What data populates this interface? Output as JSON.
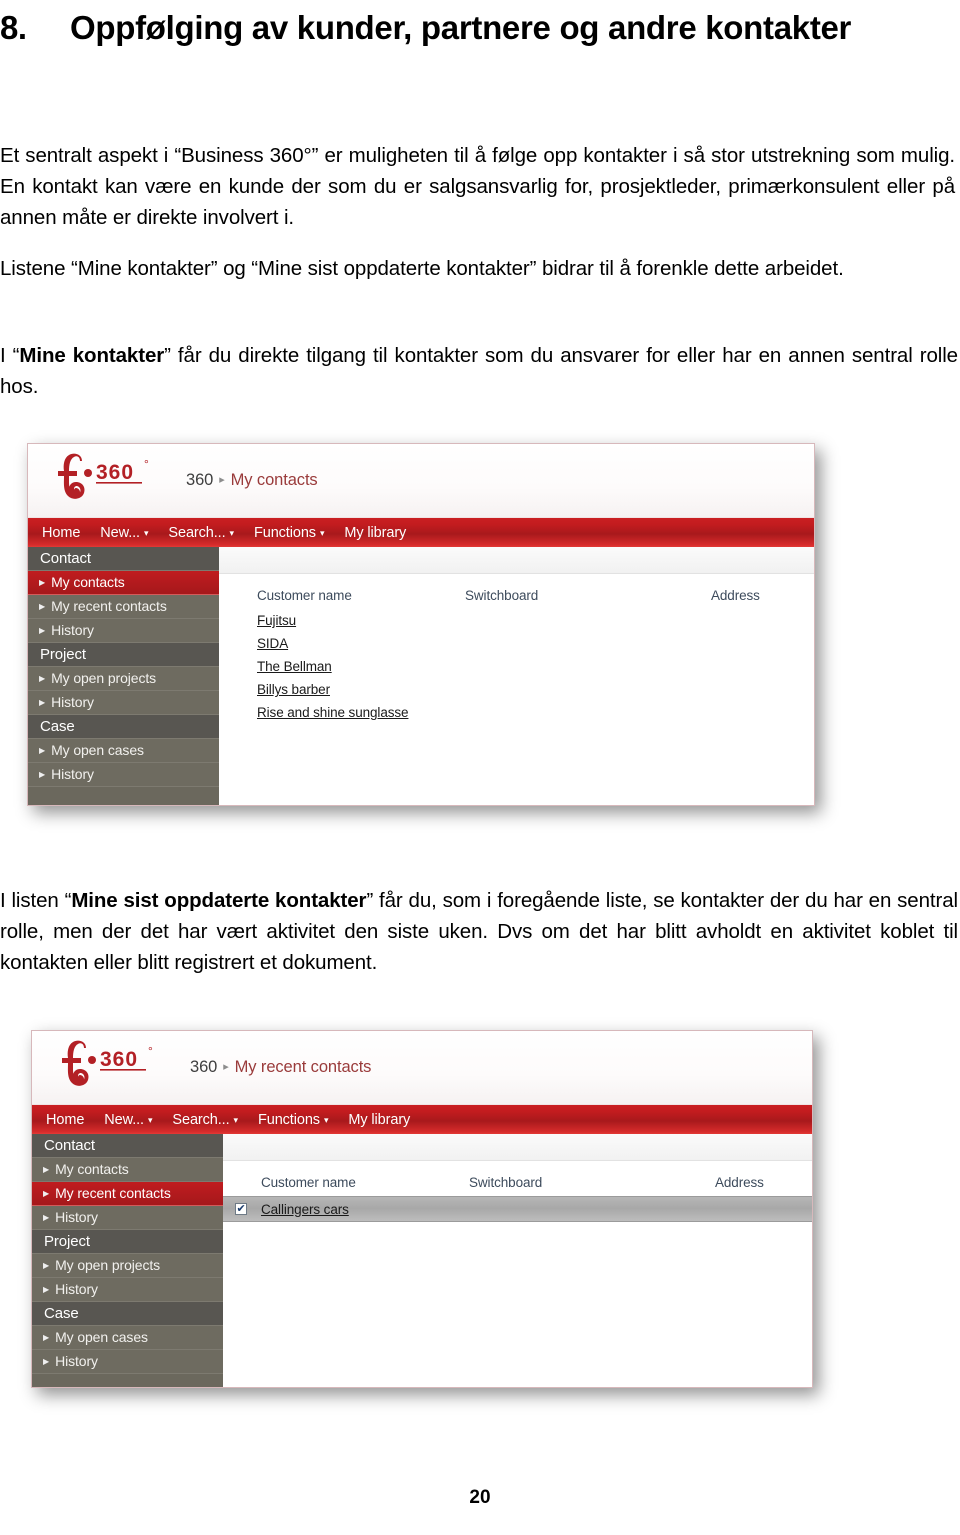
{
  "document": {
    "heading_number": "8.",
    "heading_title": "Oppfølging av kunder, partnere og andre kontakter",
    "paragraph_1": "Et sentralt aspekt i “Business 360°” er muligheten til å følge opp kontakter i så stor utstrekning som mulig. En kontakt kan være en kunde der som du er salgsansvarlig for, prosjektleder, primærkonsulent eller på annen måte er direkte involvert i.",
    "paragraph_2": "Listene “Mine kontakter” og “Mine sist oppdaterte kontakter” bidrar til å forenkle dette arbeidet.",
    "paragraph_3_pre": "I “",
    "paragraph_3_bold": "Mine kontakter",
    "paragraph_3_post": "” får du direkte tilgang til kontakter som du ansvarer for eller har en annen sentral rolle hos.",
    "paragraph_4_pre": "I listen “",
    "paragraph_4_bold": "Mine sist oppdaterte kontakter",
    "paragraph_4_post": "” får du, som i foregående liste, se kontakter der du har en sentral rolle, men der det har vært aktivitet den siste uken. Dvs om det har blitt avholdt en aktivitet koblet til kontakten eller blitt registrert et dokument.",
    "page_number": "20"
  },
  "colors": {
    "brand_red": "#c01c1f",
    "nav_red_dark": "#a8191c",
    "sidebar_group": "#585651",
    "sidebar_item": "#6e6b60",
    "breadcrumb_current": "#9a3b3b",
    "column_header": "#3d4b5c",
    "row_selected": "#a8a8a8"
  },
  "screenshot_1": {
    "logo": {
      "mark": "f360-logo-icon",
      "wordmark": "360",
      "degree": "°"
    },
    "breadcrumb": {
      "root": "360",
      "separator": "▸",
      "current": "My contacts"
    },
    "navbar": [
      {
        "label": "Home",
        "caret": false
      },
      {
        "label": "New...",
        "caret": true
      },
      {
        "label": "Search...",
        "caret": true
      },
      {
        "label": "Functions",
        "caret": true
      },
      {
        "label": "My library",
        "caret": false
      }
    ],
    "sidebar": [
      {
        "type": "group",
        "label": "Contact"
      },
      {
        "type": "item",
        "label": "My contacts",
        "active": true
      },
      {
        "type": "item",
        "label": "My recent contacts",
        "active": false
      },
      {
        "type": "item",
        "label": "History",
        "active": false
      },
      {
        "type": "group",
        "label": "Project"
      },
      {
        "type": "item",
        "label": "My open projects",
        "active": false
      },
      {
        "type": "item",
        "label": "History",
        "active": false
      },
      {
        "type": "group",
        "label": "Case"
      },
      {
        "type": "item",
        "label": "My open cases",
        "active": false
      },
      {
        "type": "item",
        "label": "History",
        "active": false
      }
    ],
    "table": {
      "columns": [
        "Customer name",
        "Switchboard",
        "Address"
      ],
      "rows": [
        {
          "customer_name": "Fujitsu",
          "switchboard": "",
          "address": "",
          "selected": false,
          "checked": false
        },
        {
          "customer_name": "SIDA",
          "switchboard": "",
          "address": "",
          "selected": false,
          "checked": false
        },
        {
          "customer_name": "The Bellman",
          "switchboard": "",
          "address": "",
          "selected": false,
          "checked": false
        },
        {
          "customer_name": "Billys barber",
          "switchboard": "",
          "address": "",
          "selected": false,
          "checked": false
        },
        {
          "customer_name": "Rise and shine sunglasse",
          "switchboard": "",
          "address": "",
          "selected": false,
          "checked": false
        }
      ]
    }
  },
  "screenshot_2": {
    "logo": {
      "mark": "f360-logo-icon",
      "wordmark": "360",
      "degree": "°"
    },
    "breadcrumb": {
      "root": "360",
      "separator": "▸",
      "current": "My recent contacts"
    },
    "navbar": [
      {
        "label": "Home",
        "caret": false
      },
      {
        "label": "New...",
        "caret": true
      },
      {
        "label": "Search...",
        "caret": true
      },
      {
        "label": "Functions",
        "caret": true
      },
      {
        "label": "My library",
        "caret": false
      }
    ],
    "sidebar": [
      {
        "type": "group",
        "label": "Contact"
      },
      {
        "type": "item",
        "label": "My contacts",
        "active": false
      },
      {
        "type": "item",
        "label": "My recent contacts",
        "active": true
      },
      {
        "type": "item",
        "label": "History",
        "active": false
      },
      {
        "type": "group",
        "label": "Project"
      },
      {
        "type": "item",
        "label": "My open projects",
        "active": false
      },
      {
        "type": "item",
        "label": "History",
        "active": false
      },
      {
        "type": "group",
        "label": "Case"
      },
      {
        "type": "item",
        "label": "My open cases",
        "active": false
      },
      {
        "type": "item",
        "label": "History",
        "active": false
      }
    ],
    "table": {
      "columns": [
        "Customer name",
        "Switchboard",
        "Address"
      ],
      "rows": [
        {
          "customer_name": "Callingers cars",
          "switchboard": "",
          "address": "",
          "selected": true,
          "checked": true
        }
      ]
    }
  }
}
